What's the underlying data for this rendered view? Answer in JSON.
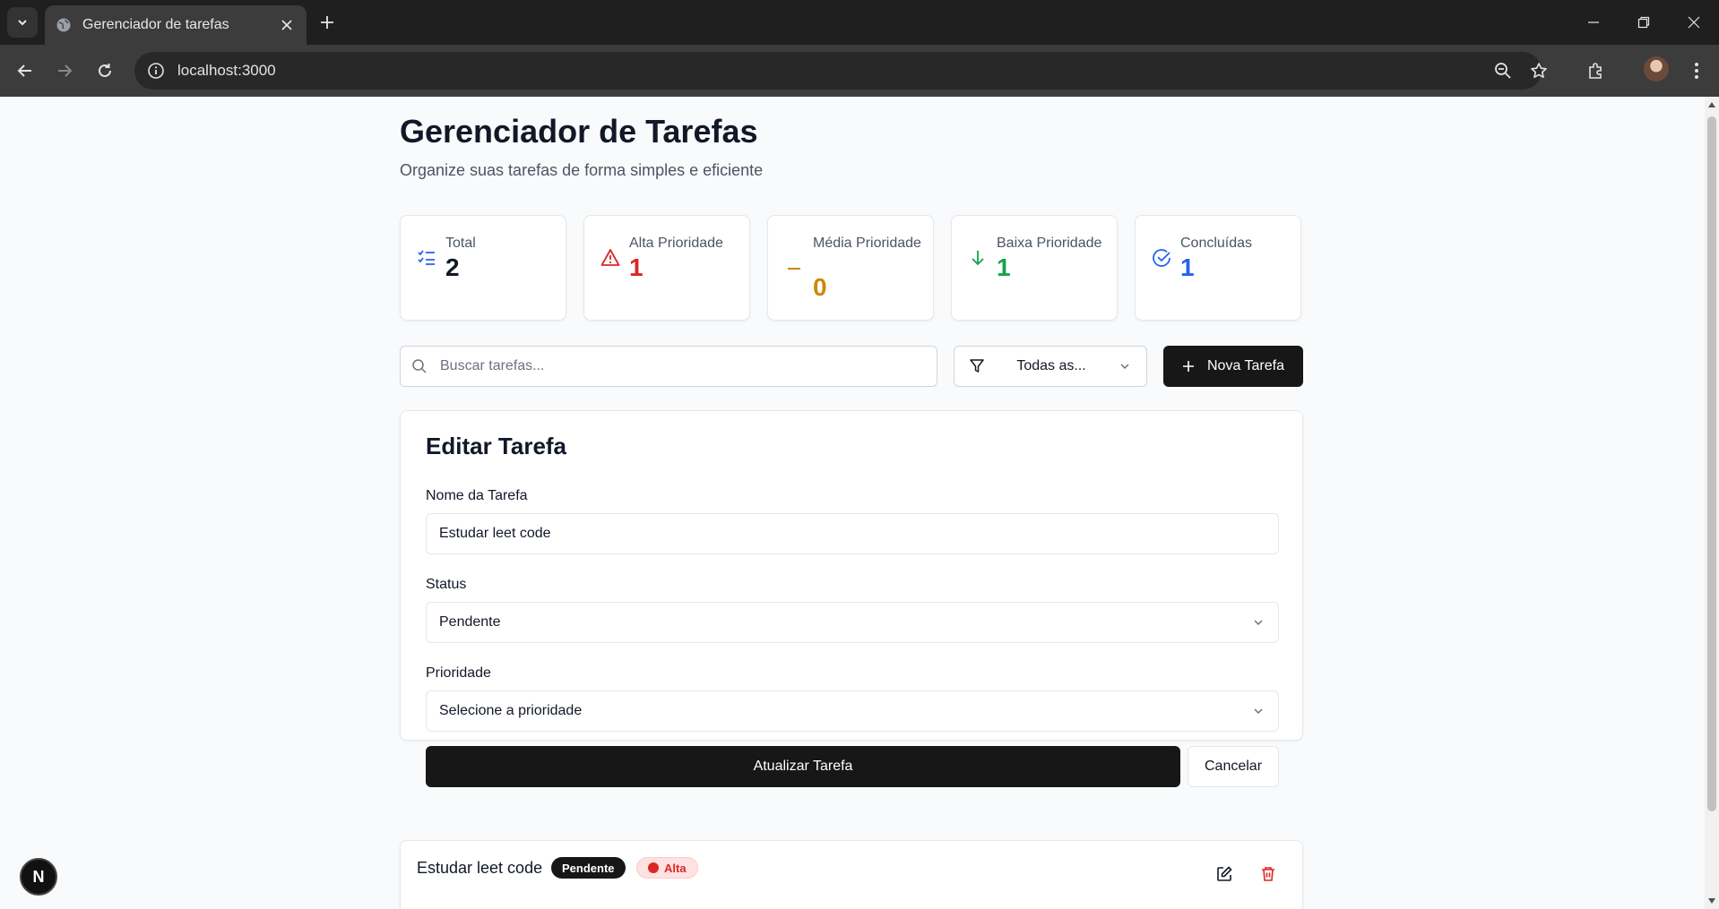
{
  "browser": {
    "tab_title": "Gerenciador de tarefas",
    "url": "localhost:3000"
  },
  "header": {
    "title": "Gerenciador de Tarefas",
    "subtitle": "Organize suas tarefas de forma simples e eficiente"
  },
  "stats": [
    {
      "label": "Total",
      "value": "2",
      "color": "#111827",
      "icon": "list-check-icon"
    },
    {
      "label": "Alta Prioridade",
      "value": "1",
      "color": "#dc2626",
      "icon": "warning-triangle-icon"
    },
    {
      "label": "Média Prioridade",
      "value": "0",
      "color": "#ca8a04",
      "icon": "minus-icon"
    },
    {
      "label": "Baixa Prioridade",
      "value": "1",
      "color": "#16a34a",
      "icon": "arrow-down-icon"
    },
    {
      "label": "Concluídas",
      "value": "1",
      "color": "#2563eb",
      "icon": "check-circle-icon"
    }
  ],
  "search": {
    "placeholder": "Buscar tarefas...",
    "value": ""
  },
  "filter": {
    "selected": "Todas as..."
  },
  "new_task_button": "Nova Tarefa",
  "form": {
    "title": "Editar Tarefa",
    "name_label": "Nome da Tarefa",
    "name_value": "Estudar leet code",
    "status_label": "Status",
    "status_value": "Pendente",
    "priority_label": "Prioridade",
    "priority_placeholder": "Selecione a prioridade",
    "submit_label": "Atualizar Tarefa",
    "cancel_label": "Cancelar"
  },
  "tasks": [
    {
      "name": "Estudar leet code",
      "status": "Pendente",
      "priority": "Alta"
    }
  ],
  "dev_badge": "N"
}
